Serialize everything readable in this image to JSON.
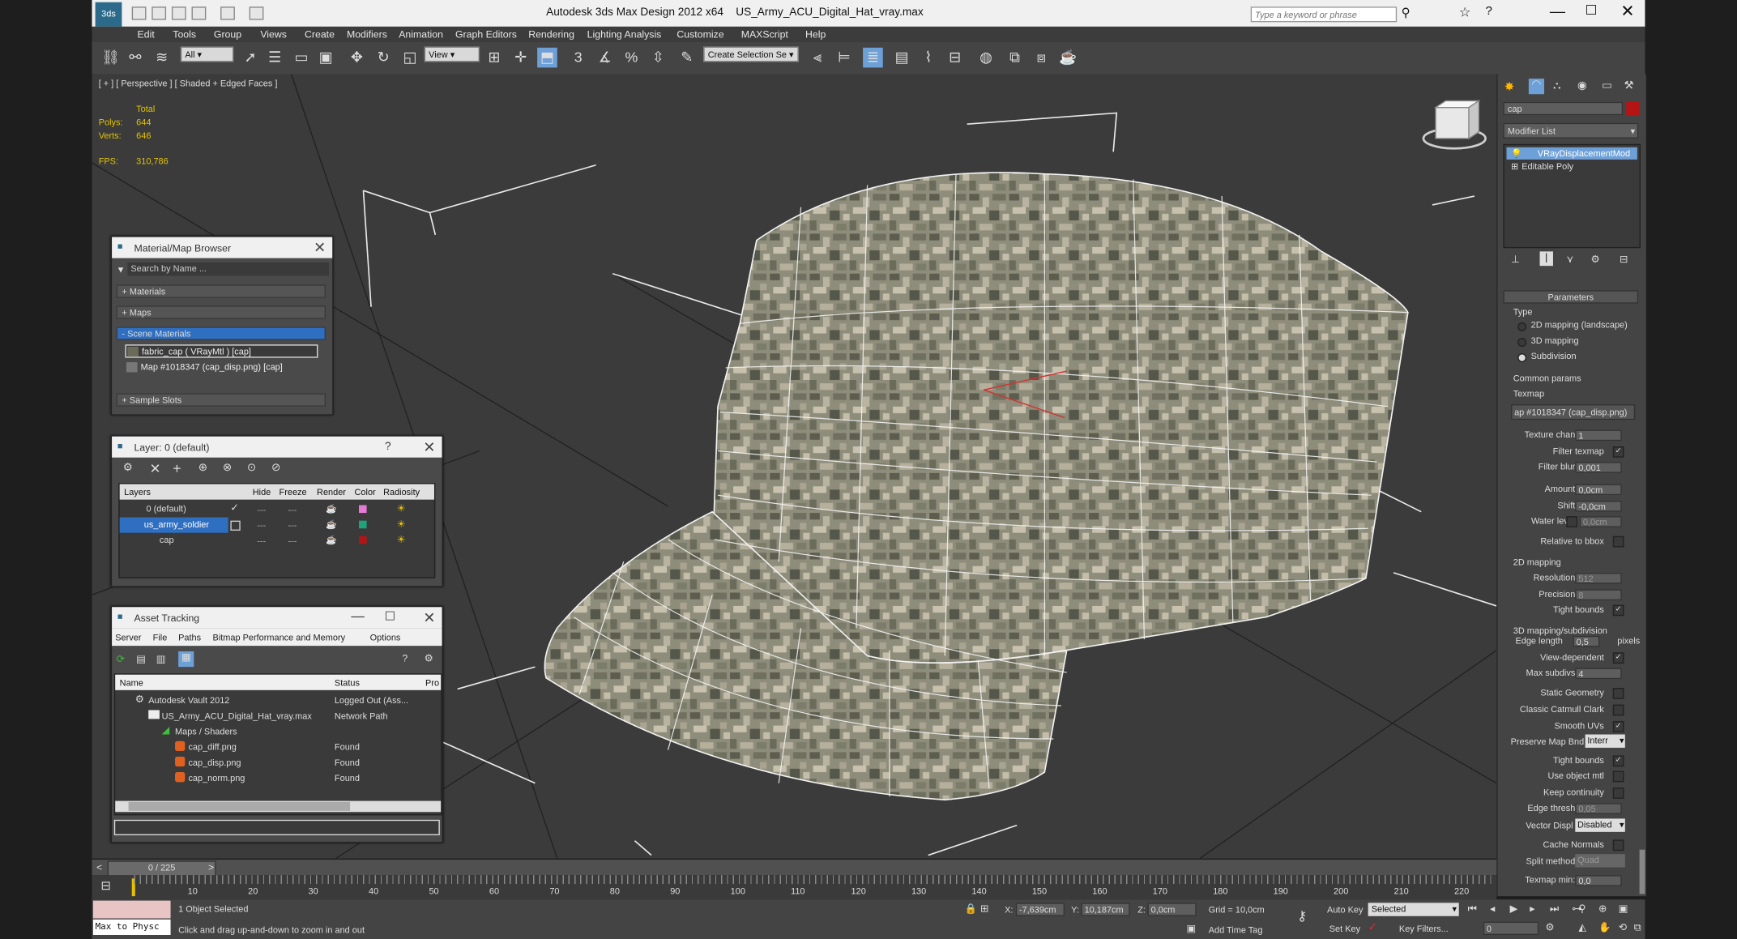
{
  "window": {
    "title": "Autodesk 3ds Max Design 2012 x64",
    "file": "US_Army_ACU_Digital_Hat_vray.max",
    "search_placeholder": "Type a keyword or phrase"
  },
  "menu": [
    "Edit",
    "Tools",
    "Group",
    "Views",
    "Create",
    "Modifiers",
    "Animation",
    "Graph Editors",
    "Rendering",
    "Lighting Analysis",
    "Customize",
    "MAXScript",
    "Help"
  ],
  "toolbar": {
    "selection_filter": "All",
    "ref_coord": "View",
    "named_selection": "Create Selection Se"
  },
  "viewport": {
    "label": "[ + ] [ Perspective ] [ Shaded + Edged Faces ]",
    "stats": {
      "total_label": "Total",
      "polys_label": "Polys:",
      "polys": "644",
      "verts_label": "Verts:",
      "verts": "646",
      "fps_label": "FPS:",
      "fps": "310,786"
    }
  },
  "material_browser": {
    "title": "Material/Map Browser",
    "search_placeholder": "Search by Name ...",
    "sections": [
      {
        "label": "+ Materials"
      },
      {
        "label": "+ Maps"
      },
      {
        "label": "- Scene Materials"
      }
    ],
    "scene_items": [
      "fabric_cap  ( VRayMtl ) [cap]",
      "Map #1018347 (cap_disp.png)  [cap]"
    ],
    "sample_slots": "+ Sample Slots"
  },
  "layer_dialog": {
    "title": "Layer: 0 (default)",
    "columns": [
      "Layers",
      "Hide",
      "Freeze",
      "Render",
      "Color",
      "Radiosity"
    ],
    "rows": [
      {
        "name": "0 (default)",
        "color": "#e67ad6"
      },
      {
        "name": "us_army_soldier",
        "color": "#1ea37a"
      },
      {
        "name": "cap",
        "color": "#b41414"
      }
    ]
  },
  "asset_tracking": {
    "title": "Asset Tracking",
    "menu": [
      "Server",
      "File",
      "Paths",
      "Bitmap Performance and Memory",
      "Options"
    ],
    "columns": [
      "Name",
      "Status",
      "Pro"
    ],
    "rows": [
      {
        "name": "Autodesk Vault 2012",
        "status": "Logged Out (Ass..."
      },
      {
        "name": "US_Army_ACU_Digital_Hat_vray.max",
        "status": "Network Path"
      },
      {
        "name": "Maps / Shaders",
        "status": ""
      },
      {
        "name": "cap_diff.png",
        "status": "Found"
      },
      {
        "name": "cap_disp.png",
        "status": "Found"
      },
      {
        "name": "cap_norm.png",
        "status": "Found"
      }
    ]
  },
  "command_panel": {
    "object_name": "cap",
    "object_color": "#b41414",
    "modifier_list": "Modifier List",
    "stack": [
      "VRayDisplacementMod",
      "Editable Poly"
    ],
    "parameters": {
      "header": "Parameters",
      "type_label": "Type",
      "types": [
        "2D mapping (landscape)",
        "3D mapping",
        "Subdivision"
      ],
      "common": "Common params",
      "texmap_label": "Texmap",
      "texmap": "ap #1018347 (cap_disp.png)",
      "texture_chan_label": "Texture chan",
      "texture_chan": "1",
      "filter_texmap": "Filter texmap",
      "filter_blur_label": "Filter blur",
      "filter_blur": "0,001",
      "amount_label": "Amount",
      "amount": "0,0cm",
      "shift_label": "Shift",
      "shift": "-0,0cm",
      "water_label": "Water level",
      "water": "0,0cm",
      "relative": "Relative to bbox",
      "mapping2d": "2D mapping",
      "resolution_label": "Resolution",
      "resolution": "512",
      "precision_label": "Precision",
      "precision": "8",
      "tight_bounds": "Tight bounds",
      "mapping3d": "3D mapping/subdivision",
      "edge_length_label": "Edge length",
      "edge_length": "0,5",
      "pixels": "pixels",
      "view_dependent": "View-dependent",
      "max_subdivs_label": "Max subdivs",
      "max_subdivs": "4",
      "static_geometry": "Static Geometry",
      "classic_catmull": "Classic Catmull Clark",
      "smooth_uvs": "Smooth UVs",
      "preserve_label": "Preserve Map Bnd",
      "preserve": "Interr",
      "tight_bounds2": "Tight bounds",
      "use_object_mtl": "Use object mtl",
      "keep_continuity": "Keep continuity",
      "edge_thresh_label": "Edge thresh",
      "edge_thresh": "0,05",
      "vector_disp_label": "Vector Displ",
      "vector_disp": "Disabled",
      "cache_normals": "Cache Normals",
      "split_method_label": "Split method",
      "split_method": "Quad",
      "texmap_min_label": "Texmap min:",
      "texmap_min": "0,0"
    }
  },
  "timeline": {
    "frame": "0 / 225",
    "ticks": [
      "10",
      "20",
      "30",
      "40",
      "50",
      "60",
      "70",
      "80",
      "90",
      "100",
      "110",
      "120",
      "130",
      "140",
      "150",
      "160",
      "170",
      "180",
      "190",
      "200",
      "210",
      "220"
    ]
  },
  "status": {
    "maxscript": "Max to Physc",
    "selection": "1 Object Selected",
    "prompt": "Click and drag up-and-down to zoom in and out",
    "x_label": "X:",
    "x": "-7,639cm",
    "y_label": "Y:",
    "y": "10,187cm",
    "z_label": "Z:",
    "z": "0,0cm",
    "grid": "Grid = 10,0cm",
    "add_time_tag": "Add Time Tag",
    "auto_key": "Auto Key",
    "set_key": "Set Key",
    "key_mode": "Selected",
    "key_filters": "Key Filters...",
    "current_frame": "0"
  }
}
